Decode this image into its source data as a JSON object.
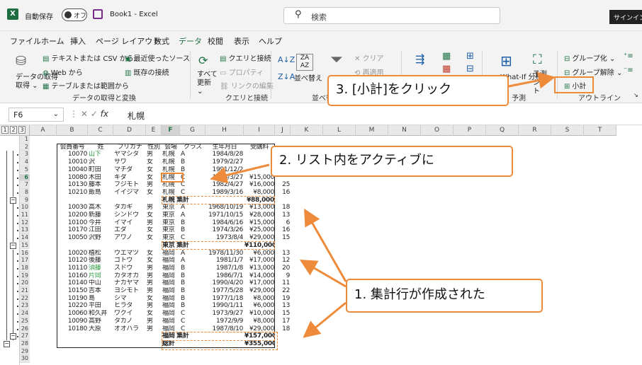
{
  "titlebar": {
    "app_icon": "excel-icon",
    "autosave_label": "自動保存",
    "autosave_state": "オフ",
    "book_title": "Book1 - Excel",
    "search_placeholder": "検索",
    "signin_label": "サインイン"
  },
  "menu": [
    "ファイル",
    "ホーム",
    "挿入",
    "ページ レイアウト",
    "数式",
    "データ",
    "校閲",
    "表示",
    "ヘルプ"
  ],
  "ribbon": {
    "get_data": {
      "label": "データの取得",
      "sub": "取得 ⌄"
    },
    "text_csv": "テキストまたは CSV から",
    "web": "Web から",
    "table_range": "テーブルまたは範囲から",
    "recent_sources": "最近使ったソース",
    "existing_conn": "既存の接続",
    "group_get_transform": "データの取得と変換",
    "refresh_all": "すべて 更新 ⌄",
    "queries_conn": "クエリと接続",
    "properties": "プロパティ",
    "edit_links": "リンクの編集",
    "group_queries": "クエリと接続",
    "sort": "並べ替え",
    "filter": "フィルター",
    "clear": "クリア",
    "reapply": "再適用",
    "group_sort_filter": "並べ替",
    "whatif": "What-If 分析",
    "forecast": "予測 シート",
    "group_forecast": "予測",
    "group_outline_btn": "グループ化 ⌄",
    "ungroup": "グループ解除 ⌄",
    "subtotal": "小計",
    "group_outline": "アウトライン"
  },
  "formula_bar": {
    "name_box": "F6",
    "fx": "fx",
    "value": "札幌"
  },
  "outline_levels": [
    "1",
    "2",
    "3"
  ],
  "columns": [
    "A",
    "B",
    "C",
    "D",
    "E",
    "F",
    "G",
    "H",
    "I",
    "J",
    "K",
    "L",
    "M",
    "N",
    "O",
    "P",
    "Q",
    "R",
    "S",
    "T"
  ],
  "rows": [
    "1",
    "2",
    "3",
    "4",
    "5",
    "6",
    "7",
    "8",
    "9",
    "10",
    "11",
    "12",
    "13",
    "14",
    "15",
    "16",
    "17",
    "18",
    "19",
    "20",
    "21",
    "22",
    "23",
    "24",
    "25",
    "26",
    "27",
    "28",
    "29",
    "30"
  ],
  "headers": [
    "会員番号",
    "姓",
    "フリガナ",
    "性別",
    "会場",
    "クラス",
    "生年月日",
    "受講料"
  ],
  "data_rows": [
    [
      "10070",
      "山下",
      "ヤマシタ",
      "男",
      "札幌",
      "A",
      "1984/8/28",
      "",
      ""
    ],
    [
      "10010",
      "沢",
      "サワ",
      "女",
      "札幌",
      "B",
      "1979/2/27",
      "",
      ""
    ],
    [
      "10040",
      "町田",
      "マチダ",
      "女",
      "札幌",
      "B",
      "1991/12/2",
      "",
      ""
    ],
    [
      "10080",
      "木田",
      "キダ",
      "女",
      "札幌",
      "C",
      "1973/3/27",
      "¥15,000",
      ""
    ],
    [
      "10130",
      "藤本",
      "フジモト",
      "男",
      "札幌",
      "C",
      "1982/4/27",
      "¥16,000",
      "25"
    ],
    [
      "10210",
      "飯島",
      "イイジマ",
      "女",
      "札幌",
      "C",
      "1989/3/16",
      "¥8,000",
      "16"
    ],
    [
      "",
      "",
      "",
      "",
      "札幌 集計",
      "",
      "",
      "¥88,000",
      ""
    ],
    [
      "10030",
      "高木",
      "タカギ",
      "男",
      "東京",
      "A",
      "1968/10/19",
      "¥13,000",
      "18"
    ],
    [
      "10200",
      "新藤",
      "シンドウ",
      "女",
      "東京",
      "A",
      "1971/10/15",
      "¥28,000",
      "13"
    ],
    [
      "10100",
      "今井",
      "イマイ",
      "男",
      "東京",
      "B",
      "1984/6/16",
      "¥15,000",
      "6"
    ],
    [
      "10170",
      "江田",
      "エダ",
      "女",
      "東京",
      "B",
      "1974/3/26",
      "¥25,000",
      "16"
    ],
    [
      "10050",
      "沢野",
      "アワノ",
      "女",
      "東京",
      "C",
      "1973/8/4",
      "¥29,000",
      "15"
    ],
    [
      "",
      "",
      "",
      "",
      "東京 集計",
      "",
      "",
      "¥110,000",
      ""
    ],
    [
      "10020",
      "植松",
      "ウエマツ",
      "女",
      "福岡",
      "A",
      "1978/11/30",
      "¥6,000",
      "13"
    ],
    [
      "10120",
      "後藤",
      "ゴトウ",
      "女",
      "福岡",
      "A",
      "1981/1/7",
      "¥17,000",
      "12"
    ],
    [
      "10110",
      "須藤",
      "スドウ",
      "男",
      "福岡",
      "B",
      "1987/1/8",
      "¥13,000",
      "20"
    ],
    [
      "10160",
      "片岡",
      "カタオカ",
      "男",
      "福岡",
      "B",
      "1986/7/1",
      "¥14,000",
      "9"
    ],
    [
      "10140",
      "中山",
      "ナカヤマ",
      "男",
      "福岡",
      "B",
      "1990/4/20",
      "¥17,000",
      "11"
    ],
    [
      "10150",
      "吉本",
      "ヨシモト",
      "男",
      "福岡",
      "B",
      "1977/5/28",
      "¥29,000",
      "22"
    ],
    [
      "10190",
      "島",
      "シマ",
      "女",
      "福岡",
      "B",
      "1977/1/18",
      "¥8,000",
      "19"
    ],
    [
      "10220",
      "平田",
      "ヒラタ",
      "男",
      "福岡",
      "B",
      "1990/1/11",
      "¥6,000",
      "13"
    ],
    [
      "10060",
      "和久井",
      "ワクイ",
      "女",
      "福岡",
      "C",
      "1973/9/27",
      "¥10,000",
      "15"
    ],
    [
      "10090",
      "高野",
      "タカノ",
      "男",
      "福岡",
      "C",
      "1972/9/9",
      "¥8,000",
      "17"
    ],
    [
      "10180",
      "大原",
      "オオハラ",
      "男",
      "福岡",
      "C",
      "1987/8/10",
      "¥29,000",
      "18"
    ],
    [
      "",
      "",
      "",
      "",
      "福岡 集計",
      "",
      "",
      "¥157,000",
      ""
    ],
    [
      "",
      "",
      "",
      "",
      "総計",
      "",
      "",
      "¥355,000",
      ""
    ]
  ],
  "callouts": {
    "step1": "1. 集計行が作成された",
    "step2": "2. リスト内をアクティブに",
    "step3": "3. [小計]をクリック"
  },
  "colors": {
    "accent": "#217346",
    "callout_border": "#ed8b3a",
    "green_name": "#2e9a3e"
  }
}
